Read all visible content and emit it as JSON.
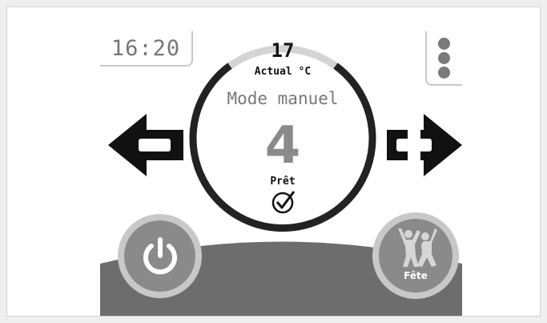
{
  "header": {
    "clock": "16:20"
  },
  "dial": {
    "actual_value": "17",
    "actual_label": "Actual °C",
    "mode_label": "Mode manuel",
    "setpoint": "4",
    "status_label": "Prêt"
  },
  "buttons": {
    "party_label": "Fête"
  },
  "icons": {
    "menu": "vertical-dots-icon",
    "decrease": "minus-arrow-icon",
    "increase": "plus-arrow-icon",
    "power": "power-icon",
    "party": "dancing-people-icon",
    "ready": "check-circle-icon"
  },
  "colors": {
    "ring_active": "#222222",
    "ring_inactive": "#d4d4d4",
    "hill": "#6d6d6d",
    "button_fill": "#8a8a8a"
  }
}
